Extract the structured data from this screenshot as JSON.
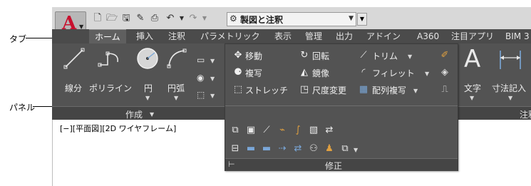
{
  "annotations": {
    "tab": "タブ",
    "panel": "パネル"
  },
  "app": {
    "logo": "A",
    "quick_access": {
      "icons": [
        "new-icon",
        "open-icon",
        "save-icon",
        "save-as-icon",
        "print-icon",
        "undo-icon",
        "redo-icon"
      ],
      "workspace": "製図と注釈"
    }
  },
  "tabs": [
    "ホーム",
    "挿入",
    "注釈",
    "パラメトリック",
    "表示",
    "管理",
    "出力",
    "アドイン",
    "A360",
    "注目アプリ",
    "BIM 3"
  ],
  "draw_panel": {
    "buttons": [
      "線分",
      "ポリライン",
      "円",
      "円弧"
    ],
    "title": "作成"
  },
  "modify_panel": {
    "rows": [
      [
        "移動",
        "回転",
        "トリム"
      ],
      [
        "複写",
        "鏡像",
        "フィレット"
      ],
      [
        "ストレッチ",
        "尺度変更",
        "配列複写"
      ]
    ],
    "title": "修正"
  },
  "annotation_panel": {
    "buttons": [
      "文字",
      "寸法記入"
    ],
    "title": "注釈"
  },
  "drawing": {
    "viewport_label": "[−][平面図][2D ワイヤフレーム]"
  },
  "colors": {
    "ribbon": "#535353",
    "tab_bar": "#4b4b4b",
    "logo": "#c8102e"
  }
}
